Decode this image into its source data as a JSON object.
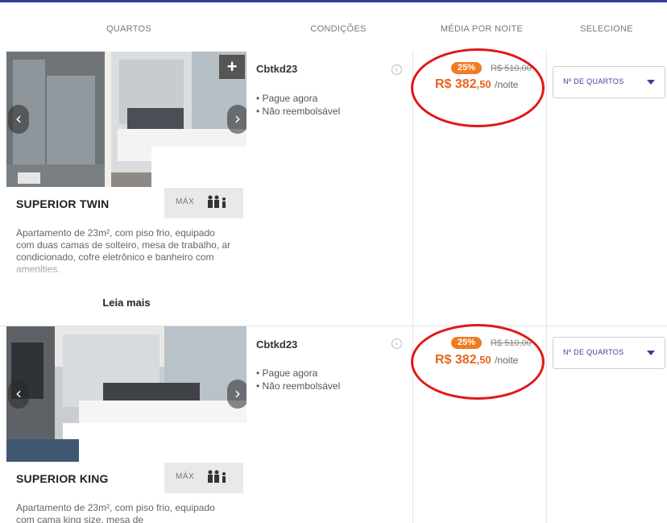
{
  "headers": {
    "rooms": "QUARTOS",
    "conditions": "CONDIÇÕES",
    "avg_per_night": "MÉDIA POR NOITE",
    "select": "SELECIONE"
  },
  "rooms": [
    {
      "name": "SUPERIOR TWIN",
      "max_label": "MÁX",
      "guests_icon": "👤👤",
      "description": "Apartamento de 23m², com piso frio, equipado com duas camas de solteiro, mesa de trabalho, ar condicionado, cofre eletrônico e banheiro com amenities.",
      "read_more": "Leia mais",
      "condition_code": "Cbtkd23",
      "conditions": [
        "• Pague agora",
        "• Não reembolsável"
      ],
      "discount": "25%",
      "old_price": "R$ 510,00",
      "price_main": "R$ 382",
      "price_cents": ",50",
      "per_night": "/noite",
      "select_label": "Nº DE QUARTOS"
    },
    {
      "name": "SUPERIOR KING",
      "max_label": "MÁX",
      "guests_icon": "👤👤",
      "description": "Apartamento de 23m², com piso frio, equipado com cama king size, mesa de",
      "condition_code": "Cbtkd23",
      "conditions": [
        "• Pague agora",
        "• Não reembolsável"
      ],
      "discount": "25%",
      "old_price": "R$ 510,00",
      "price_main": "R$ 382",
      "price_cents": ",50",
      "per_night": "/noite",
      "select_label": "Nº DE QUARTOS"
    }
  ],
  "icons": {
    "prev": "‹",
    "next": "›",
    "add": "+",
    "info": "i"
  },
  "colors": {
    "accent": "#3b3f9a",
    "price": "#e8641f",
    "discount_badge": "#f07c22",
    "highlight_circle": "#e01818"
  }
}
